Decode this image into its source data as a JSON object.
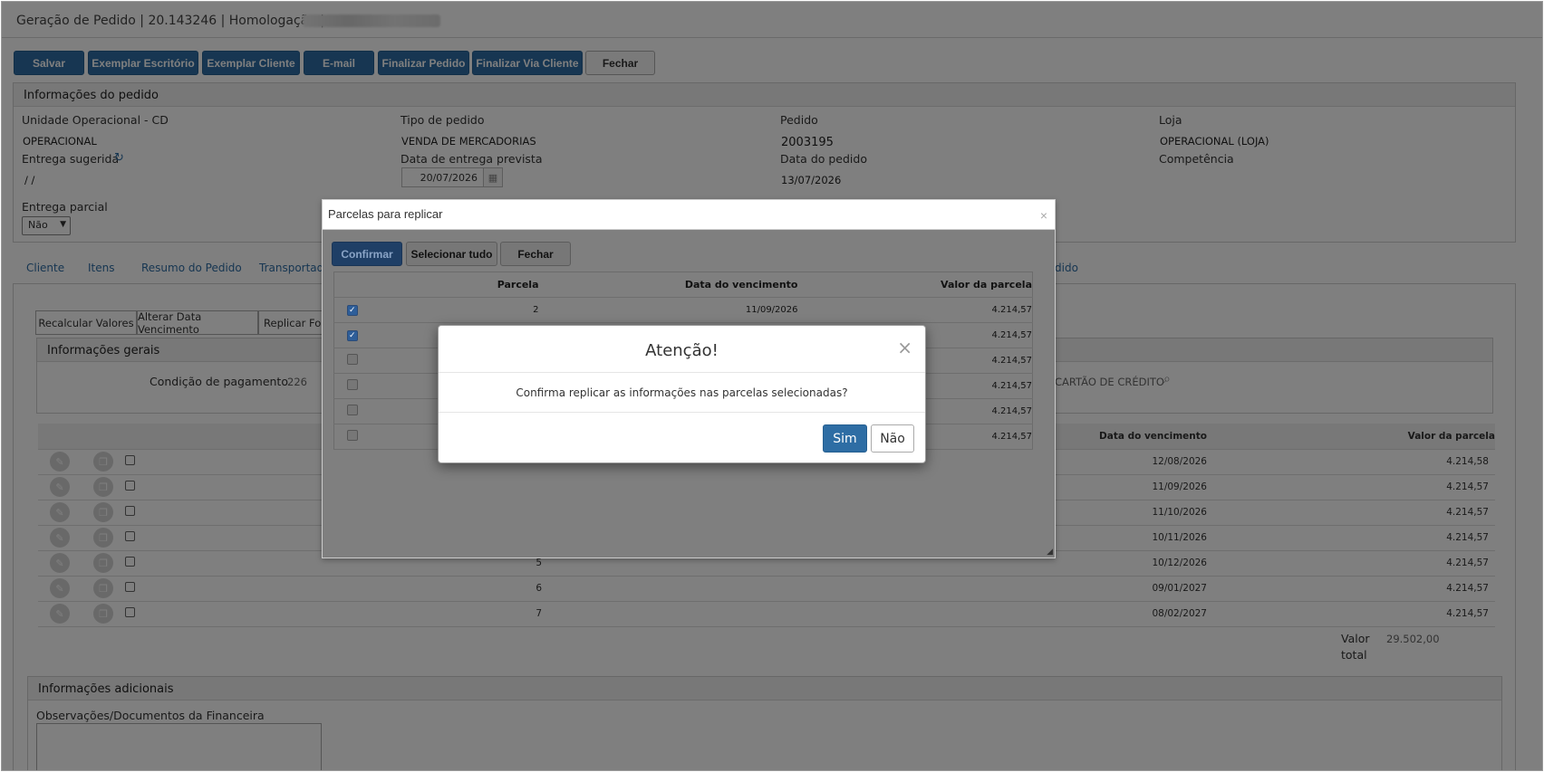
{
  "window": {
    "title": "Geração de Pedido | 20.143246 | Homologação |"
  },
  "toolbar": {
    "salvar": "Salvar",
    "exemplar_escritorio": "Exemplar Escritório",
    "exemplar_cliente": "Exemplar Cliente",
    "email": "E-mail",
    "finalizar_pedido": "Finalizar Pedido",
    "finalizar_via_cliente": "Finalizar Via Cliente",
    "fechar": "Fechar"
  },
  "info_pedido": {
    "title": "Informações do pedido",
    "unidade_label": "Unidade Operacional - CD",
    "unidade_value": "OPERACIONAL",
    "tipo_label": "Tipo de pedido",
    "tipo_value": "VENDA DE MERCADORIAS",
    "pedido_label": "Pedido",
    "pedido_value": "2003195",
    "loja_label": "Loja",
    "loja_value": "OPERACIONAL (LOJA)",
    "entrega_sugerida_label": "Entrega sugerida",
    "entrega_sugerida_value": "/ /",
    "data_prevista_label": "Data de entrega prevista",
    "data_prevista_value": "20/07/2026",
    "data_pedido_label": "Data do pedido",
    "data_pedido_value": "13/07/2026",
    "competencia_label": "Competência",
    "entrega_parcial_label": "Entrega parcial",
    "entrega_parcial_value": "Não"
  },
  "tabs": [
    "Cliente",
    "Itens",
    "Resumo do Pedido",
    "Transportado",
    "dido"
  ],
  "subtabs": [
    "Recalcular Valores",
    "Alterar Data Vencimento",
    "Replicar For"
  ],
  "info_gerais": {
    "title": "Informações gerais",
    "condicao_label": "Condição de pagamento",
    "condicao_value": "226",
    "cartao": "CARTÃO DE CRÉDITO"
  },
  "grid": {
    "col_data": "Data do vencimento",
    "col_valor": "Valor da parcela",
    "rows": [
      {
        "parcela": "",
        "data": "12/08/2026",
        "valor": "4.214,58"
      },
      {
        "parcela": "",
        "data": "11/09/2026",
        "valor": "4.214,57"
      },
      {
        "parcela": "",
        "data": "11/10/2026",
        "valor": "4.214,57"
      },
      {
        "parcela": "",
        "data": "10/11/2026",
        "valor": "4.214,57"
      },
      {
        "parcela": "5",
        "data": "10/12/2026",
        "valor": "4.214,57"
      },
      {
        "parcela": "6",
        "data": "09/01/2027",
        "valor": "4.214,57"
      },
      {
        "parcela": "7",
        "data": "08/02/2027",
        "valor": "4.214,57"
      }
    ],
    "total_label_1": "Valor",
    "total_label_2": "total",
    "total_value": "29.502,00"
  },
  "info_adicionais": {
    "title": "Informações adicionais",
    "obs_label": "Observações/Documentos da Financeira"
  },
  "dialog_parcelas": {
    "title": "Parcelas para replicar",
    "confirmar": "Confirmar",
    "selecionar_tudo": "Selecionar tudo",
    "fechar": "Fechar",
    "col_parcela": "Parcela",
    "col_data": "Data do vencimento",
    "col_valor": "Valor da parcela",
    "rows": [
      {
        "checked": true,
        "parcela": "2",
        "data": "11/09/2026",
        "valor": "4.214,57"
      },
      {
        "checked": true,
        "parcela": "",
        "data": "",
        "valor": "4.214,57"
      },
      {
        "checked": false,
        "parcela": "",
        "data": "",
        "valor": "4.214,57"
      },
      {
        "checked": false,
        "parcela": "",
        "data": "",
        "valor": "4.214,57"
      },
      {
        "checked": false,
        "parcela": "",
        "data": "",
        "valor": "4.214,57"
      },
      {
        "checked": false,
        "parcela": "",
        "data": "",
        "valor": "4.214,57"
      }
    ]
  },
  "dialog_confirm": {
    "title": "Atenção!",
    "message": "Confirma replicar as informações nas parcelas selecionadas?",
    "sim": "Sim",
    "nao": "Não"
  }
}
